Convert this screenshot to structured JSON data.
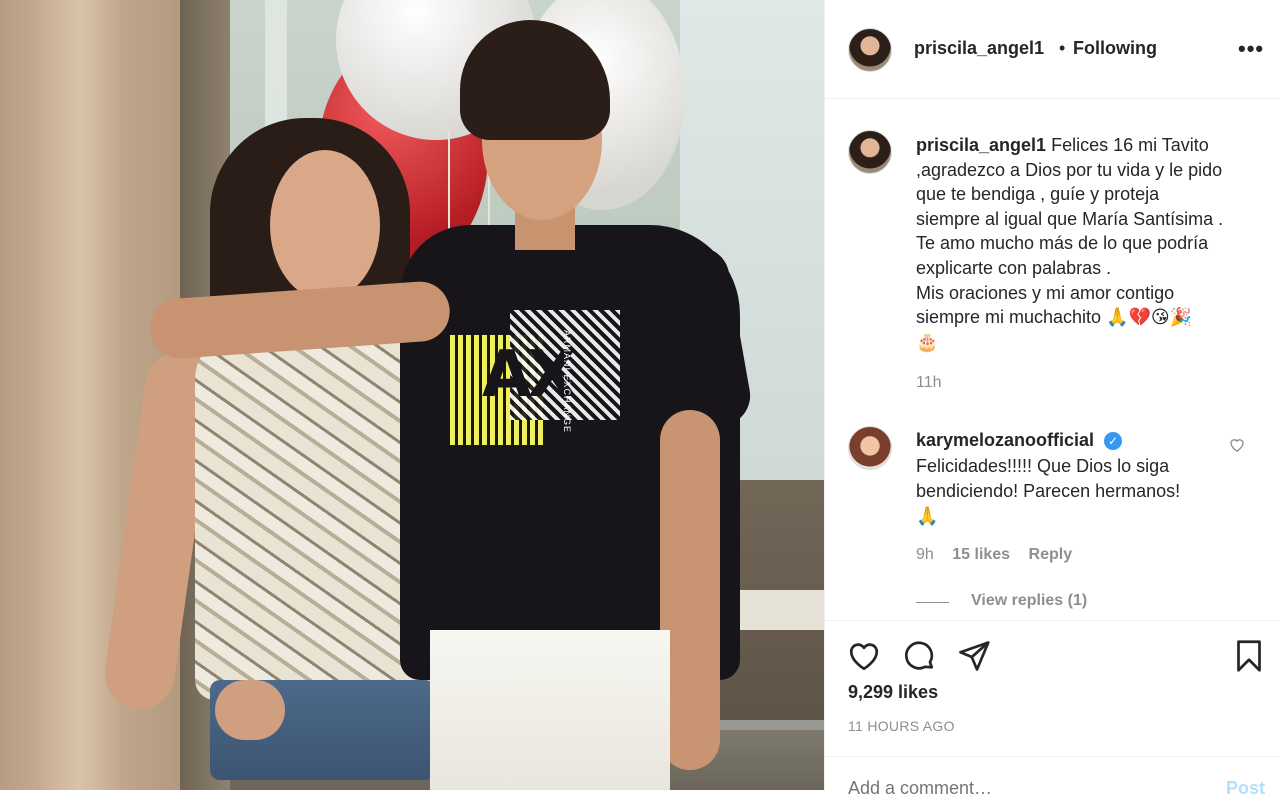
{
  "post": {
    "username": "priscila_angel1",
    "separator": "•",
    "follow_status": "Following",
    "more_icon": "more-horizontal-icon"
  },
  "caption": {
    "username": "priscila_angel1",
    "lines": [
      "Felices 16 mi Tavito",
      ",agradezco a Dios por tu vida y le pido",
      "que te bendiga , guíe y proteja",
      "siempre al igual que María Santísima .",
      "Te amo mucho más de lo que podría",
      "explicarte con palabras .",
      "Mis oraciones y mi amor contigo",
      "siempre mi muchachito 🙏💔😘🎉",
      "🎂"
    ],
    "time": "11h"
  },
  "comment": {
    "username": "karymelozanoofficial",
    "verified_icon": "verified-badge-icon",
    "text_lines": [
      "Felicidades!!!!! Que Dios lo siga",
      "bendiciendo! Parecen hermanos!",
      "🙏"
    ],
    "time": "9h",
    "likes": "15 likes",
    "reply_label": "Reply",
    "view_replies": "View replies (1)"
  },
  "actions": {
    "like_icon": "heart-icon",
    "comment_icon": "comment-icon",
    "share_icon": "share-icon",
    "save_icon": "bookmark-icon"
  },
  "likes_count": "9,299 likes",
  "posted_time": "11 HOURS AGO",
  "add_comment": {
    "placeholder": "Add a comment…",
    "post_label": "Post"
  },
  "photo": {
    "shirt_logo": "AX",
    "shirt_text": "ARMANI EXCHANGE"
  },
  "colors": {
    "text": "#262626",
    "secondary": "#8e8e8e",
    "verified": "#3897f0",
    "post_disabled": "#b2dffc",
    "divider": "#efefef"
  }
}
